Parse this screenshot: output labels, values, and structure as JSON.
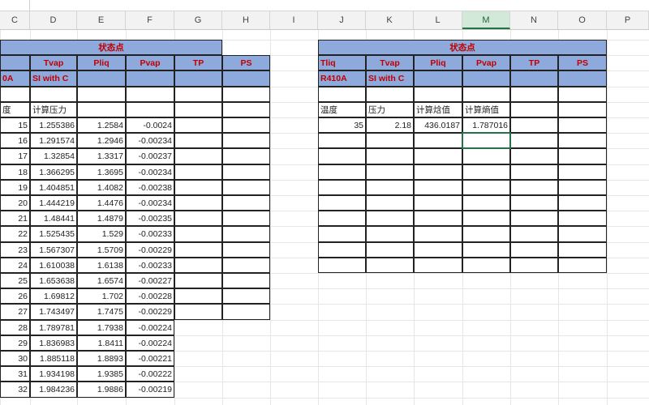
{
  "columns": [
    "C",
    "D",
    "E",
    "F",
    "G",
    "H",
    "I",
    "J",
    "K",
    "L",
    "M",
    "N",
    "O",
    "P"
  ],
  "active_column": "M",
  "left_table": {
    "title": "状态点",
    "header1": [
      "Tvap",
      "Pliq",
      "Pvap",
      "TP",
      "PS"
    ],
    "first_header_fragment": "0A",
    "si_label": "SI with C",
    "label_fragment": "度",
    "calc_pressure": "计算压力",
    "rows": [
      [
        "15",
        "1.255386",
        "1.2584",
        "-0.0024"
      ],
      [
        "16",
        "1.291574",
        "1.2946",
        "-0.00234"
      ],
      [
        "17",
        "1.32854",
        "1.3317",
        "-0.00237"
      ],
      [
        "18",
        "1.366295",
        "1.3695",
        "-0.00234"
      ],
      [
        "19",
        "1.404851",
        "1.4082",
        "-0.00238"
      ],
      [
        "20",
        "1.444219",
        "1.4476",
        "-0.00234"
      ],
      [
        "21",
        "1.48441",
        "1.4879",
        "-0.00235"
      ],
      [
        "22",
        "1.525435",
        "1.529",
        "-0.00233"
      ],
      [
        "23",
        "1.567307",
        "1.5709",
        "-0.00229"
      ],
      [
        "24",
        "1.610038",
        "1.6138",
        "-0.00233"
      ],
      [
        "25",
        "1.653638",
        "1.6574",
        "-0.00227"
      ],
      [
        "26",
        "1.69812",
        "1.702",
        "-0.00228"
      ],
      [
        "27",
        "1.743497",
        "1.7475",
        "-0.00229"
      ],
      [
        "28",
        "1.789781",
        "1.7938",
        "-0.00224"
      ],
      [
        "29",
        "1.836983",
        "1.8411",
        "-0.00224"
      ],
      [
        "30",
        "1.885118",
        "1.8893",
        "-0.00221"
      ],
      [
        "31",
        "1.934198",
        "1.9385",
        "-0.00222"
      ],
      [
        "32",
        "1.984236",
        "1.9886",
        "-0.00219"
      ]
    ]
  },
  "right_table": {
    "title": "状态点",
    "header1": [
      "Tliq",
      "Tvap",
      "Pliq",
      "Pvap",
      "TP",
      "PS"
    ],
    "refrigerant": "R410A",
    "si_label": "SI with C",
    "labels": [
      "温度",
      "压力",
      "计算焓值",
      "计算熵值"
    ],
    "values": [
      "35",
      "2.18",
      "436.0187",
      "1.787016"
    ]
  },
  "colors": {
    "header_fill": "#8ea9db",
    "header_text": "#c00000",
    "selection": "#217346"
  }
}
